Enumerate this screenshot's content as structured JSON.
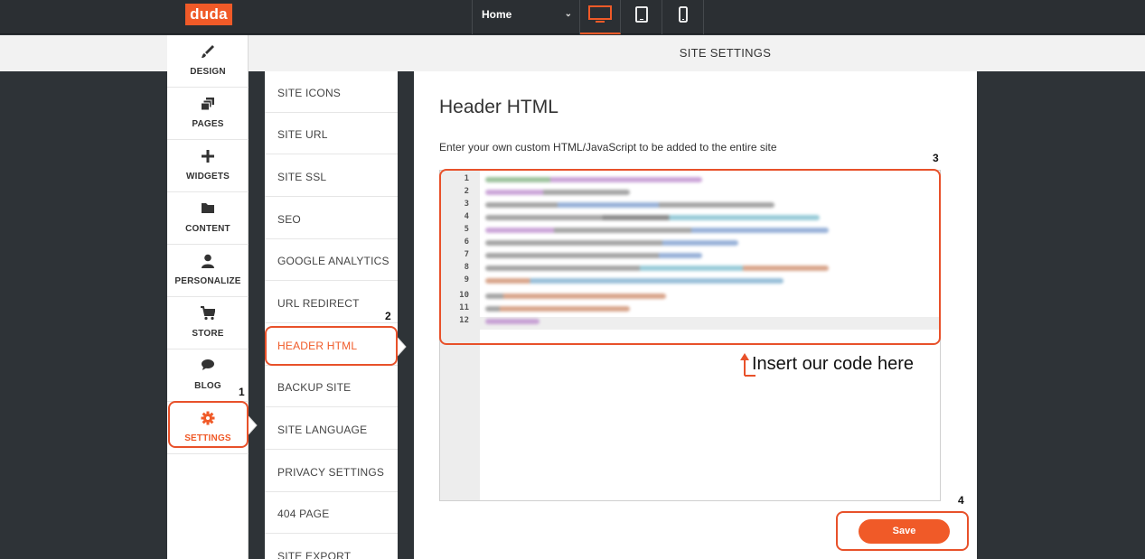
{
  "topbar": {
    "logo": "duda",
    "page_select": "Home",
    "devices": [
      "desktop-icon",
      "tablet-icon",
      "mobile-icon"
    ],
    "accent": "#f05a28"
  },
  "header": {
    "title": "SITE SETTINGS"
  },
  "leftnav": {
    "items": [
      {
        "label": "DESIGN",
        "icon": "brush-icon"
      },
      {
        "label": "PAGES",
        "icon": "pages-icon"
      },
      {
        "label": "WIDGETS",
        "icon": "plus-icon"
      },
      {
        "label": "CONTENT",
        "icon": "folder-icon"
      },
      {
        "label": "PERSONALIZE",
        "icon": "person-icon"
      },
      {
        "label": "STORE",
        "icon": "cart-icon"
      },
      {
        "label": "BLOG",
        "icon": "chat-bubble-icon"
      },
      {
        "label": "SETTINGS",
        "icon": "gear-icon"
      }
    ],
    "active": "SETTINGS"
  },
  "settings_list": {
    "items": [
      "SITE ICONS",
      "SITE URL",
      "SITE SSL",
      "SEO",
      "GOOGLE ANALYTICS",
      "URL REDIRECT",
      "HEADER HTML",
      "BACKUP SITE",
      "SITE LANGUAGE",
      "PRIVACY SETTINGS",
      "404 PAGE",
      "SITE EXPORT"
    ],
    "active": "HEADER HTML"
  },
  "panel": {
    "title": "Header HTML",
    "description": "Enter your own custom HTML/JavaScript to be added to the entire site",
    "line_numbers": [
      "1",
      "2",
      "3",
      "4",
      "5",
      "6",
      "7",
      "8",
      "9",
      "10",
      "11",
      "12"
    ],
    "save_label": "Save"
  },
  "annotations": {
    "labels": [
      "1",
      "2",
      "3",
      "4"
    ],
    "note": "Insert our code here",
    "color": "#e8512a"
  }
}
